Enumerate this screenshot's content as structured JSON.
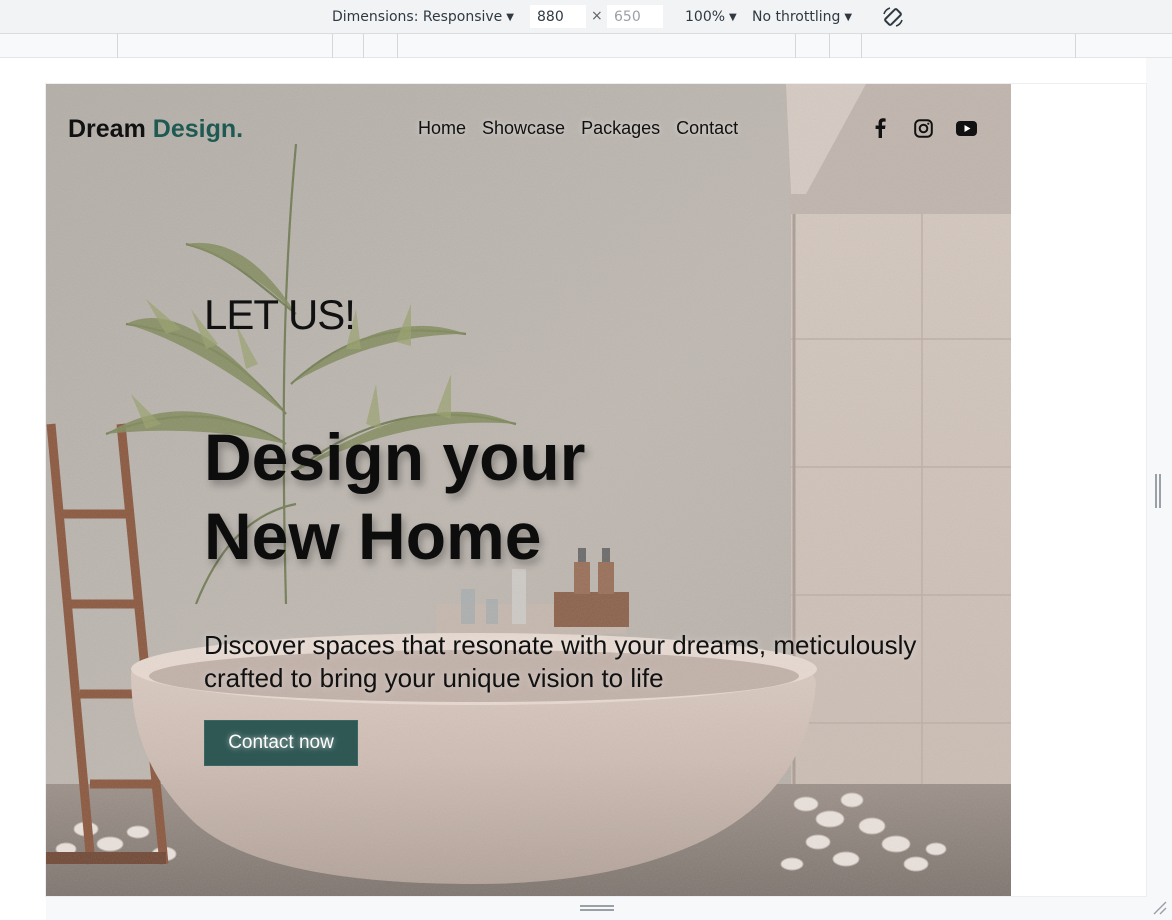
{
  "devtools": {
    "dimensions_label": "Dimensions: Responsive",
    "width_value": "880",
    "height_placeholder": "650",
    "times": "×",
    "zoom": "100%",
    "throttling": "No throttling",
    "icons": [
      "caret-down-icon",
      "rotate-icon",
      "resize-handle-icon"
    ]
  },
  "site": {
    "logo": {
      "part1": "Dream",
      "part2": "Design."
    },
    "nav": [
      "Home",
      "Showcase",
      "Packages",
      "Contact"
    ],
    "social": [
      "facebook-icon",
      "instagram-icon",
      "youtube-icon"
    ],
    "kicker": "LET US!",
    "headline_line1": "Design your",
    "headline_line2": "New Home",
    "subtext": "Discover spaces that resonate with your dreams, meticulously crafted to bring your unique vision to life",
    "cta": "Contact now",
    "colors": {
      "accent": "#1e5a52",
      "button": "#2f5754",
      "text": "#111111"
    }
  }
}
